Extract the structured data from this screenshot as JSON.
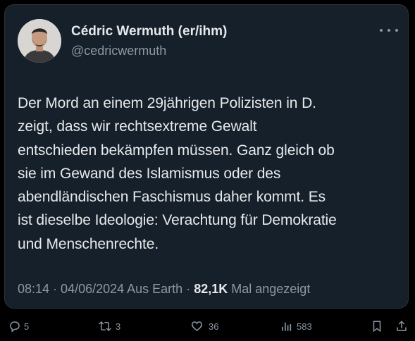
{
  "author": {
    "display_name": "Cédric Wermuth (er/ihm)",
    "handle": "@cedricwermuth"
  },
  "tweet": {
    "lines": [
      "Der Mord an einem 29jährigen Polizisten in D.",
      "zeigt, dass wir rechtsextreme Gewalt",
      "entschieden bekämpfen müssen. Ganz gleich ob",
      "sie im Gewand des Islamismus oder des",
      "abendländischen Faschismus daher kommt. Es",
      "ist dieselbe Ideologie: Verachtung für Demokratie",
      "und Menschenrechte."
    ]
  },
  "meta": {
    "time": "08:14",
    "separator": " · ",
    "date": "04/06/2024",
    "location": " Aus Earth",
    "views_count": "82,1K",
    "views_label": " Mal angezeigt"
  },
  "actions": {
    "replies": "5",
    "retweets": "3",
    "likes": "36",
    "views": "583"
  },
  "colors": {
    "card_bg": "#15202b",
    "text": "#e7e9ea",
    "muted": "#8b98a5"
  },
  "icons": [
    "more-icon",
    "reply-icon",
    "retweet-icon",
    "like-icon",
    "views-icon",
    "bookmark-icon",
    "share-icon"
  ]
}
